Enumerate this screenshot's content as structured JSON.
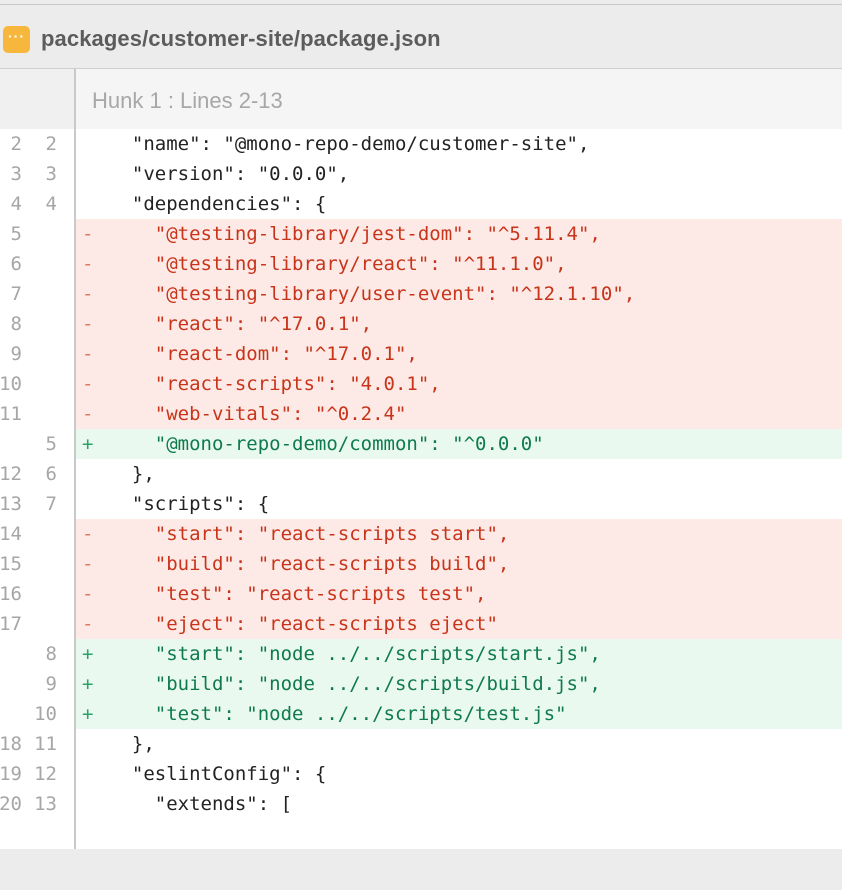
{
  "file": {
    "icon": "more-icon",
    "icon_glyph": "···",
    "path": "packages/customer-site/package.json",
    "icon_color": "#f6b73c"
  },
  "hunk": {
    "label": "Hunk 1 : Lines 2-13"
  },
  "colors": {
    "deletion_bg": "#fdeae6",
    "deletion_text": "#c8341a",
    "addition_bg": "#e9f9ef",
    "addition_text": "#0f7a4c"
  },
  "lines": [
    {
      "type": "ctx",
      "old": "2",
      "new": "2",
      "sign": "",
      "text": "  \"name\": \"@mono-repo-demo/customer-site\","
    },
    {
      "type": "ctx",
      "old": "3",
      "new": "3",
      "sign": "",
      "text": "  \"version\": \"0.0.0\","
    },
    {
      "type": "ctx",
      "old": "4",
      "new": "4",
      "sign": "",
      "text": "  \"dependencies\": {"
    },
    {
      "type": "del",
      "old": "5",
      "new": "",
      "sign": "-",
      "text": "    \"@testing-library/jest-dom\": \"^5.11.4\","
    },
    {
      "type": "del",
      "old": "6",
      "new": "",
      "sign": "-",
      "text": "    \"@testing-library/react\": \"^11.1.0\","
    },
    {
      "type": "del",
      "old": "7",
      "new": "",
      "sign": "-",
      "text": "    \"@testing-library/user-event\": \"^12.1.10\","
    },
    {
      "type": "del",
      "old": "8",
      "new": "",
      "sign": "-",
      "text": "    \"react\": \"^17.0.1\","
    },
    {
      "type": "del",
      "old": "9",
      "new": "",
      "sign": "-",
      "text": "    \"react-dom\": \"^17.0.1\","
    },
    {
      "type": "del",
      "old": "10",
      "new": "",
      "sign": "-",
      "text": "    \"react-scripts\": \"4.0.1\","
    },
    {
      "type": "del",
      "old": "11",
      "new": "",
      "sign": "-",
      "text": "    \"web-vitals\": \"^0.2.4\""
    },
    {
      "type": "add",
      "old": "",
      "new": "5",
      "sign": "+",
      "text": "    \"@mono-repo-demo/common\": \"^0.0.0\""
    },
    {
      "type": "ctx",
      "old": "12",
      "new": "6",
      "sign": "",
      "text": "  },"
    },
    {
      "type": "ctx",
      "old": "13",
      "new": "7",
      "sign": "",
      "text": "  \"scripts\": {"
    },
    {
      "type": "del",
      "old": "14",
      "new": "",
      "sign": "-",
      "text": "    \"start\": \"react-scripts start\","
    },
    {
      "type": "del",
      "old": "15",
      "new": "",
      "sign": "-",
      "text": "    \"build\": \"react-scripts build\","
    },
    {
      "type": "del",
      "old": "16",
      "new": "",
      "sign": "-",
      "text": "    \"test\": \"react-scripts test\","
    },
    {
      "type": "del",
      "old": "17",
      "new": "",
      "sign": "-",
      "text": "    \"eject\": \"react-scripts eject\""
    },
    {
      "type": "add",
      "old": "",
      "new": "8",
      "sign": "+",
      "text": "    \"start\": \"node ../../scripts/start.js\","
    },
    {
      "type": "add",
      "old": "",
      "new": "9",
      "sign": "+",
      "text": "    \"build\": \"node ../../scripts/build.js\","
    },
    {
      "type": "add",
      "old": "",
      "new": "10",
      "sign": "+",
      "text": "    \"test\": \"node ../../scripts/test.js\""
    },
    {
      "type": "ctx",
      "old": "18",
      "new": "11",
      "sign": "",
      "text": "  },"
    },
    {
      "type": "ctx",
      "old": "19",
      "new": "12",
      "sign": "",
      "text": "  \"eslintConfig\": {"
    },
    {
      "type": "ctx",
      "old": "20",
      "new": "13",
      "sign": "",
      "text": "    \"extends\": ["
    }
  ]
}
